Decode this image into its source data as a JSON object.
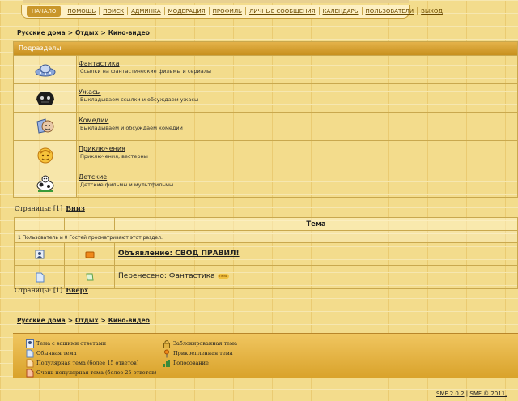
{
  "menu": [
    {
      "label": "НАЧАЛО",
      "active": true
    },
    {
      "label": "ПОМОЩЬ"
    },
    {
      "label": "ПОИСК"
    },
    {
      "label": "АДМИНКА"
    },
    {
      "label": "МОДЕРАЦИЯ"
    },
    {
      "label": "ПРОФИЛЬ"
    },
    {
      "label": "ЛИЧНЫЕ СООБЩЕНИЯ"
    },
    {
      "label": "КАЛЕНДАРЬ"
    },
    {
      "label": "ПОЛЬЗОВАТЕЛИ"
    },
    {
      "label": "ВЫХОД"
    }
  ],
  "breadcrumb": {
    "home": "Русские дома",
    "cat": "Отдых",
    "board": "Кино-видео",
    "sep": ">"
  },
  "boards": {
    "header": "Подразделы",
    "items": [
      {
        "title": "Фантастика",
        "desc": "Ссылки на фантастические фильмы и сериалы",
        "icon": "ufo-icon"
      },
      {
        "title": "Ужасы",
        "desc": "Выкладываем ссылки и обсуждаем ужасы",
        "icon": "monster-icon"
      },
      {
        "title": "Комедии",
        "desc": "Выкладываем и обсуждаем комедии",
        "icon": "comedy-icon"
      },
      {
        "title": "Приключения",
        "desc": "Приключения, вестерны",
        "icon": "adventure-icon"
      },
      {
        "title": "Детские",
        "desc": "Детские фильмы и мультфильмы",
        "icon": "kids-icon"
      }
    ]
  },
  "pager_top": {
    "label": "Страницы:",
    "current": "[1]",
    "link": "Вниз"
  },
  "pager_bottom": {
    "label": "Страницы:",
    "current": "[1]",
    "link": "Вверх"
  },
  "topics": {
    "header": "Тема",
    "viewers": "1 Пользователь и 0 Гостей просматривают этот раздел.",
    "rows": [
      {
        "title": "Объявление: СВОД ПРАВИЛ!",
        "sticky": true
      },
      {
        "title": "Перенесено: Фантастика",
        "badge": "new"
      }
    ]
  },
  "legend": {
    "left": [
      "Тема с вашими ответами",
      "Обычная тема",
      "Популярная тема (более 15 ответов)",
      "Очень популярная тема (более 25 ответов)"
    ],
    "right": [
      "Заблокированная тема",
      "Прикрепленная тема",
      "Голосование"
    ]
  },
  "footer": {
    "version": "SMF 2.0.2",
    "sep": "|",
    "copy": "SMF © 2011,"
  }
}
